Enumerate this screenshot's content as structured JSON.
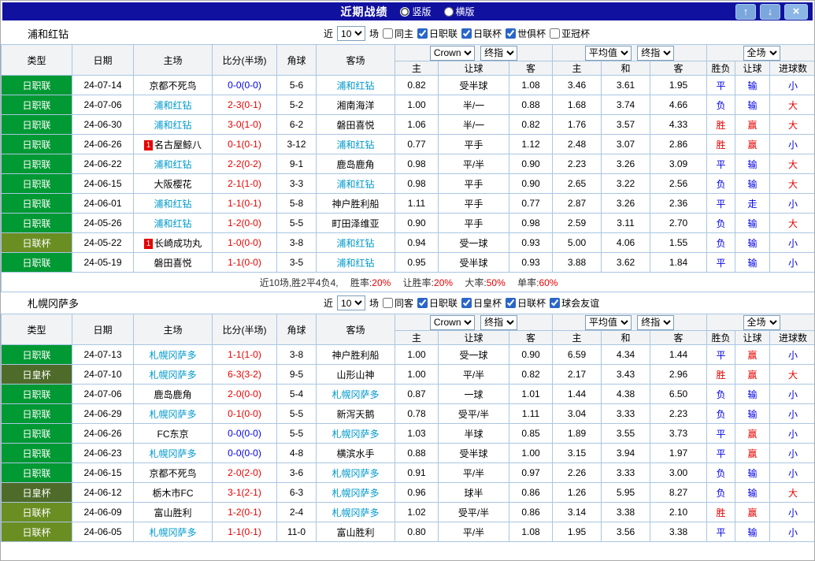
{
  "titlebar": {
    "title": "近期战绩",
    "radios": [
      {
        "label": "竖版",
        "checked": true
      },
      {
        "label": "横版",
        "checked": false
      }
    ],
    "up_icon": "↑",
    "down_icon": "↓",
    "close_icon": "×"
  },
  "table_headers": {
    "col_type": "类型",
    "col_date": "日期",
    "col_home": "主场",
    "col_score": "比分(半场)",
    "col_corner": "角球",
    "col_away": "客场",
    "bookmaker_select": "Crown",
    "final_select": "终指",
    "average_select": "平均值",
    "fullmatch_select": "全场",
    "sub_home": "主",
    "sub_handicap": "让球",
    "sub_away": "客",
    "sub_draw": "和",
    "sub_result": "胜负",
    "sub_handicap_result": "让球",
    "sub_goals": "进球数"
  },
  "sections": [
    {
      "team": "浦和红钻",
      "filter": {
        "near_label": "近",
        "count": "10",
        "games_label": "场",
        "venue": {
          "label": "同主",
          "checked": false
        },
        "leagues": [
          {
            "label": "日职联",
            "checked": true
          },
          {
            "label": "日联杯",
            "checked": true
          },
          {
            "label": "世俱杯",
            "checked": true
          },
          {
            "label": "亚冠杯",
            "checked": false
          }
        ]
      },
      "rows": [
        {
          "league": "日职联",
          "league_cls": "lg-green",
          "date": "24-07-14",
          "home": "京都不死鸟",
          "home_cls": "",
          "score": "0-0(0-0)",
          "score_cls": "t-blue",
          "corner": "5-6",
          "away": "浦和红钻",
          "away_cls": "team",
          "h_home": "0.82",
          "handicap": "受半球",
          "h_away": "1.08",
          "avg_home": "3.46",
          "avg_draw": "3.61",
          "avg_away": "1.95",
          "result": "平",
          "result_cls": "t-blue",
          "hres": "输",
          "hres_cls": "t-blue",
          "goals": "小",
          "goals_cls": "t-blue"
        },
        {
          "league": "日职联",
          "league_cls": "lg-green",
          "date": "24-07-06",
          "home": "浦和红钻",
          "home_cls": "team",
          "score": "2-3(0-1)",
          "score_cls": "t-red",
          "corner": "5-2",
          "away": "湘南海洋",
          "away_cls": "",
          "h_home": "1.00",
          "handicap": "半/一",
          "h_away": "0.88",
          "avg_home": "1.68",
          "avg_draw": "3.74",
          "avg_away": "4.66",
          "result": "负",
          "result_cls": "t-blue",
          "hres": "输",
          "hres_cls": "t-blue",
          "goals": "大",
          "goals_cls": "t-red"
        },
        {
          "league": "日职联",
          "league_cls": "lg-green",
          "date": "24-06-30",
          "home": "浦和红钻",
          "home_cls": "team",
          "score": "3-0(1-0)",
          "score_cls": "t-red",
          "corner": "6-2",
          "away": "磐田喜悦",
          "away_cls": "",
          "h_home": "1.06",
          "handicap": "半/一",
          "h_away": "0.82",
          "avg_home": "1.76",
          "avg_draw": "3.57",
          "avg_away": "4.33",
          "result": "胜",
          "result_cls": "t-red",
          "hres": "赢",
          "hres_cls": "t-red",
          "goals": "大",
          "goals_cls": "t-red"
        },
        {
          "league": "日职联",
          "league_cls": "lg-green",
          "date": "24-06-26",
          "home": "名古屋鲸八",
          "home_cls": "",
          "home_badge": "1",
          "score": "0-1(0-1)",
          "score_cls": "t-red",
          "corner": "3-12",
          "away": "浦和红钻",
          "away_cls": "team",
          "h_home": "0.77",
          "handicap": "平手",
          "h_away": "1.12",
          "avg_home": "2.48",
          "avg_draw": "3.07",
          "avg_away": "2.86",
          "result": "胜",
          "result_cls": "t-red",
          "hres": "赢",
          "hres_cls": "t-red",
          "goals": "小",
          "goals_cls": "t-blue"
        },
        {
          "league": "日职联",
          "league_cls": "lg-green",
          "date": "24-06-22",
          "home": "浦和红钻",
          "home_cls": "team",
          "score": "2-2(0-2)",
          "score_cls": "t-red",
          "corner": "9-1",
          "away": "鹿岛鹿角",
          "away_cls": "",
          "h_home": "0.98",
          "handicap": "平/半",
          "h_away": "0.90",
          "avg_home": "2.23",
          "avg_draw": "3.26",
          "avg_away": "3.09",
          "result": "平",
          "result_cls": "t-blue",
          "hres": "输",
          "hres_cls": "t-blue",
          "goals": "大",
          "goals_cls": "t-red"
        },
        {
          "league": "日职联",
          "league_cls": "lg-green",
          "date": "24-06-15",
          "home": "大阪樱花",
          "home_cls": "",
          "score": "2-1(1-0)",
          "score_cls": "t-red",
          "corner": "3-3",
          "away": "浦和红钻",
          "away_cls": "team",
          "h_home": "0.98",
          "handicap": "平手",
          "h_away": "0.90",
          "avg_home": "2.65",
          "avg_draw": "3.22",
          "avg_away": "2.56",
          "result": "负",
          "result_cls": "t-blue",
          "hres": "输",
          "hres_cls": "t-blue",
          "goals": "大",
          "goals_cls": "t-red"
        },
        {
          "league": "日职联",
          "league_cls": "lg-green",
          "date": "24-06-01",
          "home": "浦和红钻",
          "home_cls": "team",
          "score": "1-1(0-1)",
          "score_cls": "t-red",
          "corner": "5-8",
          "away": "神户胜利船",
          "away_cls": "",
          "h_home": "1.11",
          "handicap": "平手",
          "h_away": "0.77",
          "avg_home": "2.87",
          "avg_draw": "3.26",
          "avg_away": "2.36",
          "result": "平",
          "result_cls": "t-blue",
          "hres": "走",
          "hres_cls": "t-blue",
          "goals": "小",
          "goals_cls": "t-blue"
        },
        {
          "league": "日职联",
          "league_cls": "lg-green",
          "date": "24-05-26",
          "home": "浦和红钻",
          "home_cls": "team",
          "score": "1-2(0-0)",
          "score_cls": "t-red",
          "corner": "5-5",
          "away": "町田泽维亚",
          "away_cls": "",
          "h_home": "0.90",
          "handicap": "平手",
          "h_away": "0.98",
          "avg_home": "2.59",
          "avg_draw": "3.11",
          "avg_away": "2.70",
          "result": "负",
          "result_cls": "t-blue",
          "hres": "输",
          "hres_cls": "t-blue",
          "goals": "大",
          "goals_cls": "t-red"
        },
        {
          "league": "日联杯",
          "league_cls": "lg-olive",
          "date": "24-05-22",
          "home": "长崎成功丸",
          "home_cls": "",
          "home_badge": "1",
          "score": "1-0(0-0)",
          "score_cls": "t-red",
          "corner": "3-8",
          "away": "浦和红钻",
          "away_cls": "team",
          "h_home": "0.94",
          "handicap": "受一球",
          "h_away": "0.93",
          "avg_home": "5.00",
          "avg_draw": "4.06",
          "avg_away": "1.55",
          "result": "负",
          "result_cls": "t-blue",
          "hres": "输",
          "hres_cls": "t-blue",
          "goals": "小",
          "goals_cls": "t-blue"
        },
        {
          "league": "日职联",
          "league_cls": "lg-green",
          "date": "24-05-19",
          "home": "磐田喜悦",
          "home_cls": "",
          "score": "1-1(0-0)",
          "score_cls": "t-red",
          "corner": "3-5",
          "away": "浦和红钻",
          "away_cls": "team",
          "h_home": "0.95",
          "handicap": "受半球",
          "h_away": "0.93",
          "avg_home": "3.88",
          "avg_draw": "3.62",
          "avg_away": "1.84",
          "result": "平",
          "result_cls": "t-blue",
          "hres": "输",
          "hres_cls": "t-blue",
          "goals": "小",
          "goals_cls": "t-blue"
        }
      ],
      "summary": {
        "prefix": "近10场,胜2平4负4,",
        "stats": [
          {
            "label": "胜率:",
            "value": "20%"
          },
          {
            "label": "让胜率:",
            "value": "20%"
          },
          {
            "label": "大率:",
            "value": "50%"
          },
          {
            "label": "单率:",
            "value": "60%"
          }
        ]
      }
    },
    {
      "team": "札幌冈萨多",
      "filter": {
        "near_label": "近",
        "count": "10",
        "games_label": "场",
        "venue": {
          "label": "同客",
          "checked": false
        },
        "leagues": [
          {
            "label": "日职联",
            "checked": true
          },
          {
            "label": "日皇杯",
            "checked": true
          },
          {
            "label": "日联杯",
            "checked": true
          },
          {
            "label": "球会友谊",
            "checked": true
          }
        ]
      },
      "rows": [
        {
          "league": "日职联",
          "league_cls": "lg-green",
          "date": "24-07-13",
          "home": "札幌冈萨多",
          "home_cls": "team",
          "score": "1-1(1-0)",
          "score_cls": "t-red",
          "corner": "3-8",
          "away": "神户胜利船",
          "away_cls": "",
          "h_home": "1.00",
          "handicap": "受一球",
          "h_away": "0.90",
          "avg_home": "6.59",
          "avg_draw": "4.34",
          "avg_away": "1.44",
          "result": "平",
          "result_cls": "t-blue",
          "hres": "赢",
          "hres_cls": "t-red",
          "goals": "小",
          "goals_cls": "t-blue"
        },
        {
          "league": "日皇杯",
          "league_cls": "lg-dark",
          "date": "24-07-10",
          "home": "札幌冈萨多",
          "home_cls": "team",
          "score": "6-3(3-2)",
          "score_cls": "t-red",
          "corner": "9-5",
          "away": "山形山神",
          "away_cls": "",
          "h_home": "1.00",
          "handicap": "平/半",
          "h_away": "0.82",
          "avg_home": "2.17",
          "avg_draw": "3.43",
          "avg_away": "2.96",
          "result": "胜",
          "result_cls": "t-red",
          "hres": "赢",
          "hres_cls": "t-red",
          "goals": "大",
          "goals_cls": "t-red"
        },
        {
          "league": "日职联",
          "league_cls": "lg-green",
          "date": "24-07-06",
          "home": "鹿岛鹿角",
          "home_cls": "",
          "score": "2-0(0-0)",
          "score_cls": "t-red",
          "corner": "5-4",
          "away": "札幌冈萨多",
          "away_cls": "team",
          "h_home": "0.87",
          "handicap": "一球",
          "h_away": "1.01",
          "avg_home": "1.44",
          "avg_draw": "4.38",
          "avg_away": "6.50",
          "result": "负",
          "result_cls": "t-blue",
          "hres": "输",
          "hres_cls": "t-blue",
          "goals": "小",
          "goals_cls": "t-blue"
        },
        {
          "league": "日职联",
          "league_cls": "lg-green",
          "date": "24-06-29",
          "home": "札幌冈萨多",
          "home_cls": "team",
          "score": "0-1(0-0)",
          "score_cls": "t-red",
          "corner": "5-5",
          "away": "新泻天鹅",
          "away_cls": "",
          "h_home": "0.78",
          "handicap": "受平/半",
          "h_away": "1.11",
          "avg_home": "3.04",
          "avg_draw": "3.33",
          "avg_away": "2.23",
          "result": "负",
          "result_cls": "t-blue",
          "hres": "输",
          "hres_cls": "t-blue",
          "goals": "小",
          "goals_cls": "t-blue"
        },
        {
          "league": "日职联",
          "league_cls": "lg-green",
          "date": "24-06-26",
          "home": "FC东京",
          "home_cls": "",
          "score": "0-0(0-0)",
          "score_cls": "t-blue",
          "corner": "5-5",
          "away": "札幌冈萨多",
          "away_cls": "team",
          "h_home": "1.03",
          "handicap": "半球",
          "h_away": "0.85",
          "avg_home": "1.89",
          "avg_draw": "3.55",
          "avg_away": "3.73",
          "result": "平",
          "result_cls": "t-blue",
          "hres": "赢",
          "hres_cls": "t-red",
          "goals": "小",
          "goals_cls": "t-blue"
        },
        {
          "league": "日职联",
          "league_cls": "lg-green",
          "date": "24-06-23",
          "home": "札幌冈萨多",
          "home_cls": "team",
          "score": "0-0(0-0)",
          "score_cls": "t-blue",
          "corner": "4-8",
          "away": "横滨水手",
          "away_cls": "",
          "h_home": "0.88",
          "handicap": "受半球",
          "h_away": "1.00",
          "avg_home": "3.15",
          "avg_draw": "3.94",
          "avg_away": "1.97",
          "result": "平",
          "result_cls": "t-blue",
          "hres": "赢",
          "hres_cls": "t-red",
          "goals": "小",
          "goals_cls": "t-blue"
        },
        {
          "league": "日职联",
          "league_cls": "lg-green",
          "date": "24-06-15",
          "home": "京都不死鸟",
          "home_cls": "",
          "score": "2-0(2-0)",
          "score_cls": "t-red",
          "corner": "3-6",
          "away": "札幌冈萨多",
          "away_cls": "team",
          "h_home": "0.91",
          "handicap": "平/半",
          "h_away": "0.97",
          "avg_home": "2.26",
          "avg_draw": "3.33",
          "avg_away": "3.00",
          "result": "负",
          "result_cls": "t-blue",
          "hres": "输",
          "hres_cls": "t-blue",
          "goals": "小",
          "goals_cls": "t-blue"
        },
        {
          "league": "日皇杯",
          "league_cls": "lg-dark",
          "date": "24-06-12",
          "home": "栃木市FC",
          "home_cls": "",
          "score": "3-1(2-1)",
          "score_cls": "t-red",
          "corner": "6-3",
          "away": "札幌冈萨多",
          "away_cls": "team",
          "h_home": "0.96",
          "handicap": "球半",
          "h_away": "0.86",
          "avg_home": "1.26",
          "avg_draw": "5.95",
          "avg_away": "8.27",
          "result": "负",
          "result_cls": "t-blue",
          "hres": "输",
          "hres_cls": "t-blue",
          "goals": "大",
          "goals_cls": "t-red"
        },
        {
          "league": "日联杯",
          "league_cls": "lg-olive",
          "date": "24-06-09",
          "home": "富山胜利",
          "home_cls": "",
          "score": "1-2(0-1)",
          "score_cls": "t-red",
          "corner": "2-4",
          "away": "札幌冈萨多",
          "away_cls": "team",
          "h_home": "1.02",
          "handicap": "受平/半",
          "h_away": "0.86",
          "avg_home": "3.14",
          "avg_draw": "3.38",
          "avg_away": "2.10",
          "result": "胜",
          "result_cls": "t-red",
          "hres": "赢",
          "hres_cls": "t-red",
          "goals": "小",
          "goals_cls": "t-blue"
        },
        {
          "league": "日联杯",
          "league_cls": "lg-olive",
          "date": "24-06-05",
          "home": "札幌冈萨多",
          "home_cls": "team",
          "score": "1-1(0-1)",
          "score_cls": "t-red",
          "corner": "11-0",
          "away": "富山胜利",
          "away_cls": "",
          "h_home": "0.80",
          "handicap": "平/半",
          "h_away": "1.08",
          "avg_home": "1.95",
          "avg_draw": "3.56",
          "avg_away": "3.38",
          "result": "平",
          "result_cls": "t-blue",
          "hres": "输",
          "hres_cls": "t-blue",
          "goals": "小",
          "goals_cls": "t-blue"
        }
      ]
    }
  ]
}
